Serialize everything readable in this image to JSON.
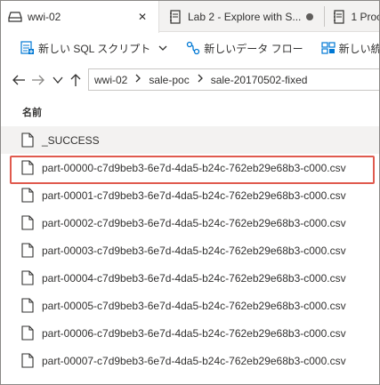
{
  "tabs": [
    {
      "label": "wwi-02",
      "icon": "storage-icon",
      "close": "✕"
    },
    {
      "label": "Lab 2 - Explore with S...",
      "icon": "notebook-icon"
    },
    {
      "label": "1 Proc",
      "icon": "notebook-icon"
    }
  ],
  "toolbar": {
    "new_sql_script": "新しい SQL スクリプト",
    "new_dataflow": "新しいデータ フロー",
    "new_integration": "新しい統合"
  },
  "breadcrumb": [
    "wwi-02",
    "sale-poc",
    "sale-20170502-fixed"
  ],
  "list": {
    "column_name": "名前",
    "files": [
      "_SUCCESS",
      "part-00000-c7d9beb3-6e7d-4da5-b24c-762eb29e68b3-c000.csv",
      "part-00001-c7d9beb3-6e7d-4da5-b24c-762eb29e68b3-c000.csv",
      "part-00002-c7d9beb3-6e7d-4da5-b24c-762eb29e68b3-c000.csv",
      "part-00003-c7d9beb3-6e7d-4da5-b24c-762eb29e68b3-c000.csv",
      "part-00004-c7d9beb3-6e7d-4da5-b24c-762eb29e68b3-c000.csv",
      "part-00005-c7d9beb3-6e7d-4da5-b24c-762eb29e68b3-c000.csv",
      "part-00006-c7d9beb3-6e7d-4da5-b24c-762eb29e68b3-c000.csv",
      "part-00007-c7d9beb3-6e7d-4da5-b24c-762eb29e68b3-c000.csv"
    ],
    "selected_index": 0,
    "highlighted_index": 1
  },
  "colors": {
    "highlight_border": "#e05a4e",
    "selected_bg": "#f3f2f1",
    "accent_blue": "#0078d4"
  }
}
